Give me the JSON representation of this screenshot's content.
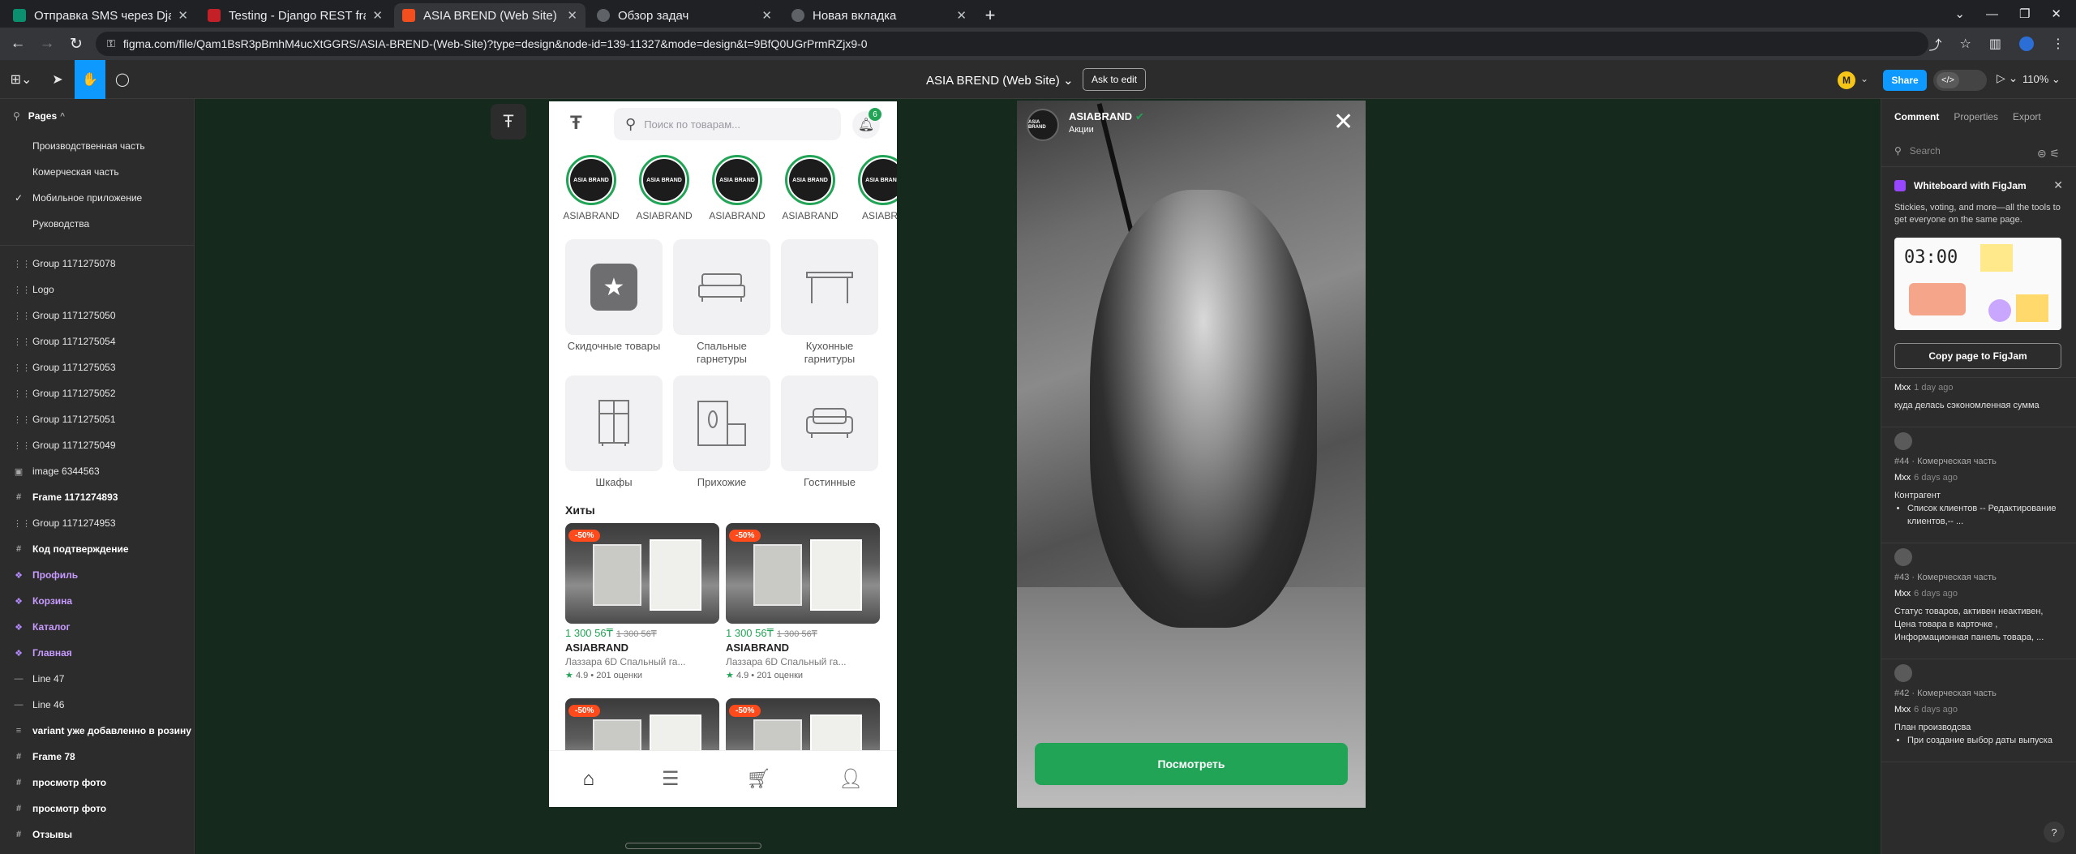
{
  "browser": {
    "tabs": [
      {
        "title": "Отправка SMS через Dja",
        "fav_color": "#0c8f6e",
        "active": false
      },
      {
        "title": "Testing - Django REST fra",
        "fav_color": "#c32028",
        "active": false
      },
      {
        "title": "ASIA BREND (Web Site) –",
        "fav_color": "#f24e1e",
        "active": true
      },
      {
        "title": "Обзор задач",
        "fav_color": "#5f6368",
        "active": false
      },
      {
        "title": "Новая вкладка",
        "fav_color": "#5f6368",
        "active": false
      }
    ],
    "url": "figma.com/file/Qam1BsR3pBmhM4ucXtGGRS/ASIA-BREND-(Web-Site)?type=design&node-id=139-11327&mode=design&t=9BfQ0UGrPrmRZjx9-0"
  },
  "figma": {
    "file_title": "ASIA BREND (Web Site)",
    "ask_to_edit": "Ask to edit",
    "share": "Share",
    "zoom": "110%",
    "avatar_initial": "M"
  },
  "left_panel": {
    "pages_label": "Pages",
    "pages": [
      {
        "label": "Производственная часть",
        "current": false
      },
      {
        "label": "Комерческая часть",
        "current": false
      },
      {
        "label": "Мобильное приложение",
        "current": true
      },
      {
        "label": "Руководства",
        "current": false
      }
    ],
    "layers": [
      {
        "label": "Group 1171275078",
        "kind": "group"
      },
      {
        "label": "Logo",
        "kind": "group"
      },
      {
        "label": "Group 1171275050",
        "kind": "group"
      },
      {
        "label": "Group 1171275054",
        "kind": "group"
      },
      {
        "label": "Group 1171275053",
        "kind": "group"
      },
      {
        "label": "Group 1171275052",
        "kind": "group"
      },
      {
        "label": "Group 1171275051",
        "kind": "group"
      },
      {
        "label": "Group 1171275049",
        "kind": "group"
      },
      {
        "label": "image 6344563",
        "kind": "image"
      },
      {
        "label": "Frame 1171274893",
        "kind": "frame"
      },
      {
        "label": "Group 1171274953",
        "kind": "group"
      },
      {
        "label": "Код подтверждение",
        "kind": "frame"
      },
      {
        "label": "Профиль",
        "kind": "component"
      },
      {
        "label": "Корзина",
        "kind": "component"
      },
      {
        "label": "Каталог",
        "kind": "component"
      },
      {
        "label": "Главная",
        "kind": "component"
      },
      {
        "label": "Line 47",
        "kind": "line"
      },
      {
        "label": "Line 46",
        "kind": "line"
      },
      {
        "label": "variant уже добавленно в розину",
        "kind": "text"
      },
      {
        "label": "Frame 78",
        "kind": "frame"
      },
      {
        "label": "просмотр фото",
        "kind": "frame"
      },
      {
        "label": "просмотр фото",
        "kind": "frame"
      },
      {
        "label": "Отзывы",
        "kind": "frame"
      }
    ]
  },
  "phone": {
    "search_placeholder": "Поиск по товарам...",
    "bell_badge": "6",
    "stories": [
      {
        "label": "ASIABRAND",
        "logo": "ASIA BRAND"
      },
      {
        "label": "ASIABRAND",
        "logo": "ASIA BRAND"
      },
      {
        "label": "ASIABRAND",
        "logo": "ASIA BRAND"
      },
      {
        "label": "ASIABRAND",
        "logo": "ASIA BRAND"
      },
      {
        "label": "ASIABRA",
        "logo": "ASIA BRAND"
      }
    ],
    "categories": [
      {
        "label": "Скидочные товары",
        "icon": "star-icon"
      },
      {
        "label": "Спальные гарнетуры",
        "icon": "bed-icon"
      },
      {
        "label": "Кухонные гарнитуры",
        "icon": "table-icon"
      },
      {
        "label": "Шкафы",
        "icon": "wardrobe-icon"
      },
      {
        "label": "Прихожие",
        "icon": "hallway-icon"
      },
      {
        "label": "Гостинные",
        "icon": "sofa-icon"
      }
    ],
    "hits_title": "Хиты",
    "products": [
      {
        "sale": "-50%",
        "price": "1 300 56₸",
        "old_price": "1 300 56₸",
        "brand": "ASIABRAND",
        "name": "Лаззара 6D Спальный га...",
        "rating": "4.9",
        "reviews": "201 оценки"
      },
      {
        "sale": "-50%",
        "price": "1 300 56₸",
        "old_price": "1 300 56₸",
        "brand": "ASIABRAND",
        "name": "Лаззара 6D Спальный га...",
        "rating": "4.9",
        "reviews": "201 оценки"
      },
      {
        "sale": "-50%"
      },
      {
        "sale": "-50%"
      }
    ]
  },
  "story": {
    "name": "ASIABRAND",
    "subtitle": "Акции",
    "button": "Посмотреть",
    "avatar_logo": "ASIA BRAND"
  },
  "right_panel": {
    "tabs": [
      "Comment",
      "Properties",
      "Export"
    ],
    "search_placeholder": "Search",
    "whiteboard": {
      "title": "Whiteboard with FigJam",
      "desc": "Stickies, voting, and more—all the tools to get everyone on the same page.",
      "timer": "03:00",
      "copy_button": "Copy page to FigJam"
    },
    "comments": [
      {
        "meta": "",
        "author": "Mxx",
        "time": "1 day ago",
        "body": "куда делась сэкономленная сумма",
        "items": []
      },
      {
        "meta": "#44 · Комерческая часть",
        "author": "Mxx",
        "time": "6 days ago",
        "body": "Контрагент",
        "items": [
          "Список клиентов -- Редактирование клиентов,-- ..."
        ]
      },
      {
        "meta": "#43 · Комерческая часть",
        "author": "Mxx",
        "time": "6 days ago",
        "body": "Статус товаров, активен неактивен, Цена товара в карточке , Информационная панель товара, ...",
        "items": []
      },
      {
        "meta": "#42 · Комерческая часть",
        "author": "Mxx",
        "time": "6 days ago",
        "body": "План производсва",
        "items": [
          "При создание выбор даты выпуска"
        ]
      }
    ],
    "help": "?"
  },
  "colors": {
    "figma_blue": "#0d99ff",
    "brand_green": "#22a456",
    "sale_red": "#ff4a1c",
    "canvas_bg": "#16291d"
  }
}
